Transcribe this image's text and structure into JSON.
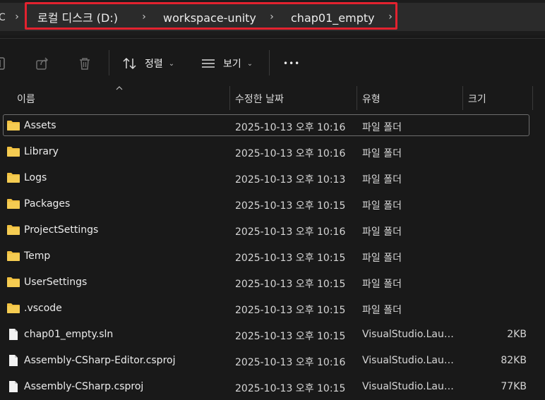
{
  "address_bar": {
    "partial_left": "C",
    "separator": "›",
    "segments": [
      "로컬 디스크 (D:)",
      "workspace-unity",
      "chap01_empty"
    ]
  },
  "toolbar": {
    "sort_label": "정렬",
    "view_label": "보기",
    "more_label": "•••"
  },
  "columns": {
    "name": "이름",
    "modified": "수정한 날짜",
    "type": "유형",
    "size": "크기"
  },
  "files": [
    {
      "name": "Assets",
      "modified": "2025-10-13 오후 10:16",
      "type": "파일 폴더",
      "size": "",
      "kind": "folder-icon",
      "selected": true
    },
    {
      "name": "Library",
      "modified": "2025-10-13 오후 10:16",
      "type": "파일 폴더",
      "size": "",
      "kind": "folder-icon"
    },
    {
      "name": "Logs",
      "modified": "2025-10-13 오후 10:13",
      "type": "파일 폴더",
      "size": "",
      "kind": "folder-icon"
    },
    {
      "name": "Packages",
      "modified": "2025-10-13 오후 10:15",
      "type": "파일 폴더",
      "size": "",
      "kind": "folder-icon"
    },
    {
      "name": "ProjectSettings",
      "modified": "2025-10-13 오후 10:16",
      "type": "파일 폴더",
      "size": "",
      "kind": "folder-icon"
    },
    {
      "name": "Temp",
      "modified": "2025-10-13 오후 10:15",
      "type": "파일 폴더",
      "size": "",
      "kind": "folder-icon"
    },
    {
      "name": "UserSettings",
      "modified": "2025-10-13 오후 10:15",
      "type": "파일 폴더",
      "size": "",
      "kind": "folder-icon"
    },
    {
      "name": ".vscode",
      "modified": "2025-10-13 오후 10:15",
      "type": "파일 폴더",
      "size": "",
      "kind": "folder-icon"
    },
    {
      "name": "chap01_empty.sln",
      "modified": "2025-10-13 오후 10:15",
      "type": "VisualStudio.Laun...",
      "size": "2KB",
      "kind": "file-icon"
    },
    {
      "name": "Assembly-CSharp-Editor.csproj",
      "modified": "2025-10-13 오후 10:16",
      "type": "VisualStudio.Laun...",
      "size": "82KB",
      "kind": "file-icon"
    },
    {
      "name": "Assembly-CSharp.csproj",
      "modified": "2025-10-13 오후 10:15",
      "type": "VisualStudio.Laun...",
      "size": "77KB",
      "kind": "file-icon"
    }
  ],
  "colors": {
    "highlight": "#e3222f",
    "folder": "#f0c040",
    "background": "#191919"
  }
}
